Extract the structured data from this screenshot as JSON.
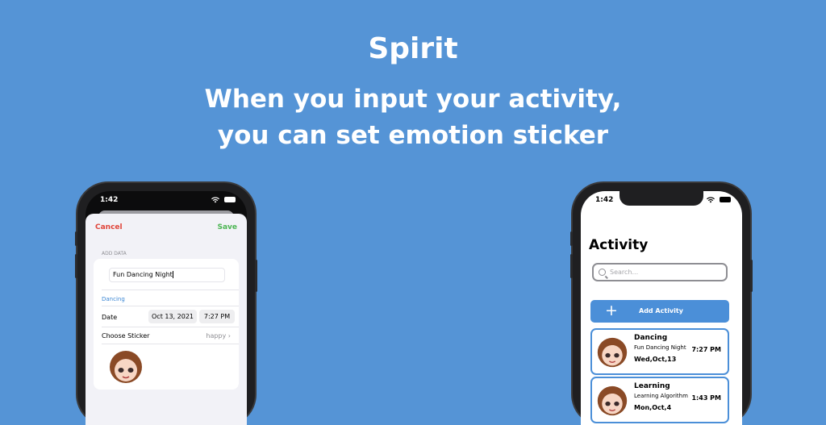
{
  "hero": {
    "title": "Spirit",
    "line1": "When you input your activity,",
    "line2": "you can set emotion sticker"
  },
  "left_phone": {
    "status_time": "1:42",
    "cancel": "Cancel",
    "save": "Save",
    "section_header": "ADD DATA",
    "name_value": "Fun Dancing Night",
    "category": "Dancing",
    "date_label": "Date",
    "date_value": "Oct 13, 2021",
    "time_value": "7:27 PM",
    "sticker_label": "Choose Sticker",
    "sticker_value": "happy",
    "chevron": "›"
  },
  "right_phone": {
    "status_time": "1:42",
    "title": "Activity",
    "search_placeholder": "Search...",
    "add_label": "Add Activity",
    "activities": [
      {
        "title": "Dancing",
        "name": "Fun Dancing Night",
        "date": "Wed,Oct,13",
        "time": "7:27 PM"
      },
      {
        "title": "Learning",
        "name": "Learning Algorithm",
        "date": "Mon,Oct,4",
        "time": "1:43 PM"
      }
    ]
  },
  "colors": {
    "background": "#5594d6",
    "accent": "#4b8fd8",
    "cancel": "#e0453a",
    "save": "#4bb552"
  }
}
